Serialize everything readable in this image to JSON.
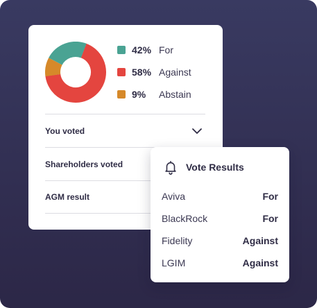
{
  "colors": {
    "for": "#4aa393",
    "against": "#e4453f",
    "abstain": "#d6892a"
  },
  "breakdown": [
    {
      "pct": "42%",
      "label": "For",
      "share": 0.23
    },
    {
      "pct": "58%",
      "label": "Against",
      "share": 0.67
    },
    {
      "pct": "9%",
      "label": "Abstain",
      "share": 0.1
    }
  ],
  "sections": [
    {
      "label": "You voted"
    },
    {
      "label": "Shareholders voted"
    },
    {
      "label": "AGM result"
    }
  ],
  "popup": {
    "icon": "bell-icon",
    "title": "Vote Results",
    "rows": [
      {
        "name": "Aviva",
        "vote": "For"
      },
      {
        "name": "BlackRock",
        "vote": "For"
      },
      {
        "name": "Fidelity",
        "vote": "Against"
      },
      {
        "name": "LGIM",
        "vote": "Against"
      }
    ]
  }
}
